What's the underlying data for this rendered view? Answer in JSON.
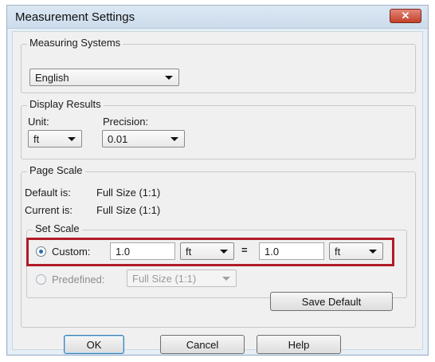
{
  "dialog": {
    "title": "Measurement Settings",
    "close_label": "✕"
  },
  "measuring_systems": {
    "legend": "Measuring Systems",
    "selected": "English"
  },
  "display_results": {
    "legend": "Display Results",
    "unit_label": "Unit:",
    "unit_value": "ft",
    "precision_label": "Precision:",
    "precision_value": "0.01"
  },
  "page_scale": {
    "legend": "Page Scale",
    "default_label": "Default is:",
    "default_value": "Full Size (1:1)",
    "current_label": "Current is:",
    "current_value": "Full Size (1:1)",
    "set_scale": {
      "legend": "Set Scale",
      "custom_label": "Custom:",
      "custom_selected": true,
      "left_value": "1.0",
      "left_unit": "ft",
      "equals": "=",
      "right_value": "1.0",
      "right_unit": "ft",
      "predefined_label": "Predefined:",
      "predefined_value": "Full Size (1:1)",
      "predefined_enabled": false
    },
    "save_default_label": "Save Default"
  },
  "buttons": {
    "ok": "OK",
    "cancel": "Cancel",
    "help": "Help"
  },
  "colors": {
    "highlight": "#b01b27",
    "close_button": "#c3402a"
  }
}
